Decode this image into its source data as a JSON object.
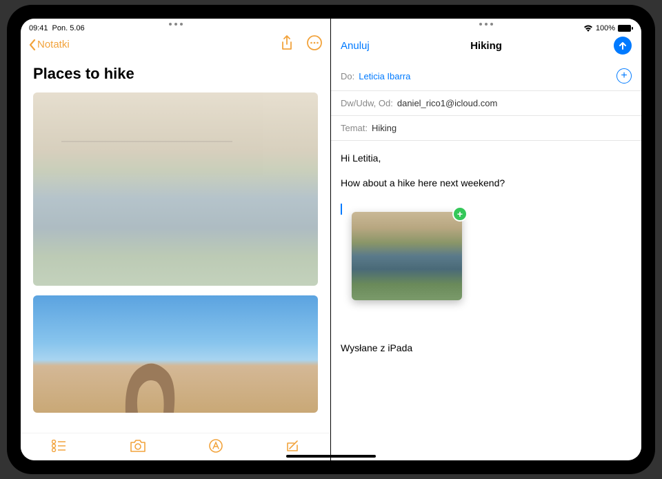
{
  "status": {
    "time": "09:41",
    "date": "Pon. 5.06",
    "battery": "100%"
  },
  "notes": {
    "back_label": "Notatki",
    "title": "Places to hike"
  },
  "mail": {
    "cancel": "Anuluj",
    "title": "Hiking",
    "to_label": "Do:",
    "to_recipient": "Leticia Ibarra",
    "cc_label": "Dw/Udw, Od:",
    "cc_value": "daniel_rico1@icloud.com",
    "subject_label": "Temat:",
    "subject_value": "Hiking",
    "body_greeting": "Hi Letitia,",
    "body_line": "How about a hike here next weekend?",
    "signature": "Wysłane z iPada"
  }
}
